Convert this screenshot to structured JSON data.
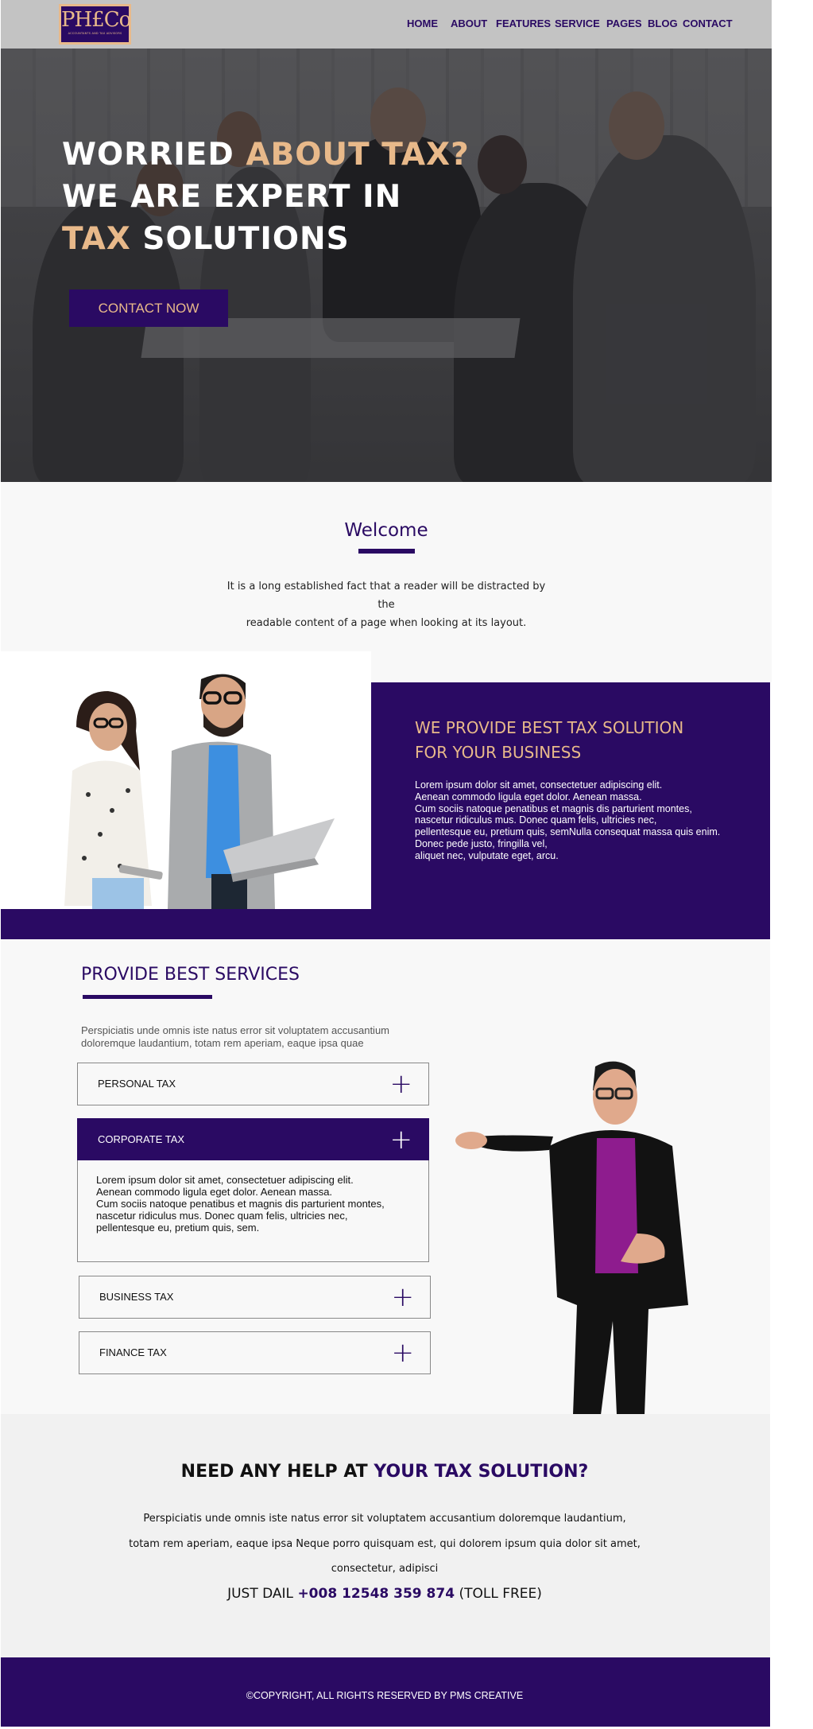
{
  "brand": {
    "logo_mark": "PH£Co",
    "logo_tagline": "ACCOUNTANTS AND TAX ADVISORS"
  },
  "nav": {
    "items": [
      {
        "label": "HOME"
      },
      {
        "label": "ABOUT"
      },
      {
        "label": "FEATURES"
      },
      {
        "label": "SERVICE"
      },
      {
        "label": "PAGES"
      },
      {
        "label": "BLOG"
      },
      {
        "label": "CONTACT"
      }
    ]
  },
  "hero": {
    "line1_white": "WORRIED ",
    "line1_accent": "ABOUT TAX?",
    "line2": "WE ARE EXPERT IN",
    "line3_accent": "TAX",
    "line3_white": " SOLUTIONS",
    "cta_label": "CONTACT NOW"
  },
  "welcome": {
    "title": "Welcome",
    "text_line1": "It is a long established fact that a reader will be distracted by the",
    "text_line2": "readable content of a page when looking at its layout."
  },
  "provide": {
    "title_line1": "WE PROVIDE BEST TAX SOLUTION",
    "title_line2": "FOR YOUR BUSINESS",
    "body": "Lorem ipsum dolor sit amet, consectetuer adipiscing elit.\nAenean commodo ligula eget dolor. Aenean massa.\nCum sociis natoque penatibus et magnis dis parturient montes,\nnascetur ridiculus mus. Donec quam felis, ultricies nec,\npellentesque eu, pretium quis, semNulla consequat massa quis enim.\nDonec pede justo, fringilla vel,\n aliquet nec, vulputate eget, arcu."
  },
  "services": {
    "title": "PROVIDE BEST SERVICES",
    "intro": "Perspiciatis unde omnis iste natus error sit voluptatem accusantium\n doloremque laudantium, totam rem aperiam, eaque ipsa quae",
    "items": [
      {
        "label": "PERSONAL TAX",
        "icon": "plus-icon"
      },
      {
        "label": "CORPORATE TAX",
        "icon": "plus-icon"
      },
      {
        "label": "BUSINESS TAX",
        "icon": "plus-icon"
      },
      {
        "label": "FINANCE TAX",
        "icon": "plus-icon"
      }
    ],
    "plus_glyph": "+",
    "open_panel_text": "Lorem ipsum dolor sit amet, consectetuer adipiscing elit.\nAenean commodo ligula eget dolor. Aenean massa.\nCum sociis natoque penatibus et magnis dis parturient montes,\nnascetur ridiculus mus. Donec quam felis, ultricies nec,\npellentesque eu, pretium quis, sem."
  },
  "help": {
    "title_plain": "NEED ANY HELP AT ",
    "title_accent": "YOUR TAX SOLUTION?",
    "line1": "Perspiciatis unde omnis iste natus error sit voluptatem accusantium doloremque laudantium,",
    "line2": "totam rem aperiam, eaque ipsa Neque porro quisquam est, qui dolorem ipsum quia dolor sit amet,",
    "line3": "consectetur, adipisci",
    "phone_prefix": "JUST DAIL ",
    "phone_number": "+008 12548 359 874",
    "phone_suffix": " (TOLL FREE)"
  },
  "footer": {
    "copyright": "©COPYRIGHT, ALL RIGHTS RESERVED BY PMS CREATIVE"
  },
  "colors": {
    "brand_purple": "#2a0a63",
    "accent_gold": "#e8b98a"
  }
}
